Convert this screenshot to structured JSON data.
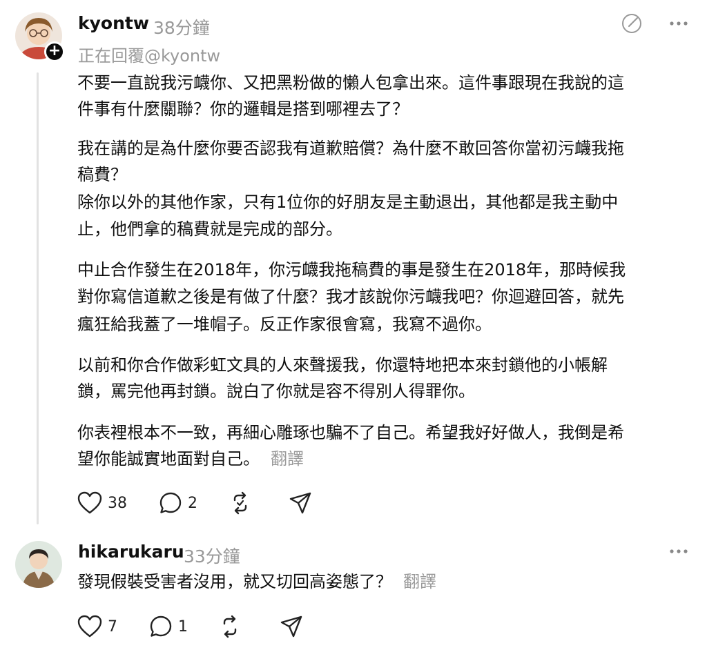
{
  "post1": {
    "username": "kyontw",
    "time": "38分鐘",
    "replying": "正在回覆@kyontw",
    "paragraphs": [
      "不要一直說我污衊你、又把黑粉做的懶人包拿出來。這件事跟現在我說的這",
      "件事有什麼關聯？你的邏輯是搭到哪裡去了？",
      "我在講的是為什麼你要否認我有道歉賠償？為什麼不敢回答你當初污衊我拖",
      "稿費？",
      "除你以外的其他作家，只有1位你的好朋友是主動退出，其他都是我主動中",
      "止，他們拿的稿費就是完成的部分。",
      "中止合作發生在2018年，你污衊我拖稿費的事是發生在2018年，那時候我",
      "對你寫信道歉之後是有做了什麼？我才該說你污衊我吧？你迴避回答，就先",
      "瘋狂給我蓋了一堆帽子。反正作家很會寫，我寫不過你。",
      "以前和你合作做彩虹文具的人來聲援我，你還特地把本來封鎖他的小帳解",
      "鎖，罵完他再封鎖。說白了你就是容不得別人得罪你。",
      "你表裡根本不一致，再細心雕琢也騙不了自己。希望我好好做人，我倒是希",
      "望你能誠實地面對自己。"
    ],
    "translate": "翻譯",
    "likes": "38",
    "comments": "2"
  },
  "post2": {
    "username": "hikarukaru",
    "time": "33分鐘",
    "text": "發現假裝受害者沒用，就又切回高姿態了？",
    "translate": "翻譯",
    "likes": "7",
    "comments": "1"
  },
  "icons": {
    "heart": "heart-icon",
    "comment": "comment-icon",
    "repost": "repost-icon",
    "share": "share-icon",
    "more": "more-icon",
    "edit": "edit-circle-icon",
    "plus": "plus-icon"
  }
}
